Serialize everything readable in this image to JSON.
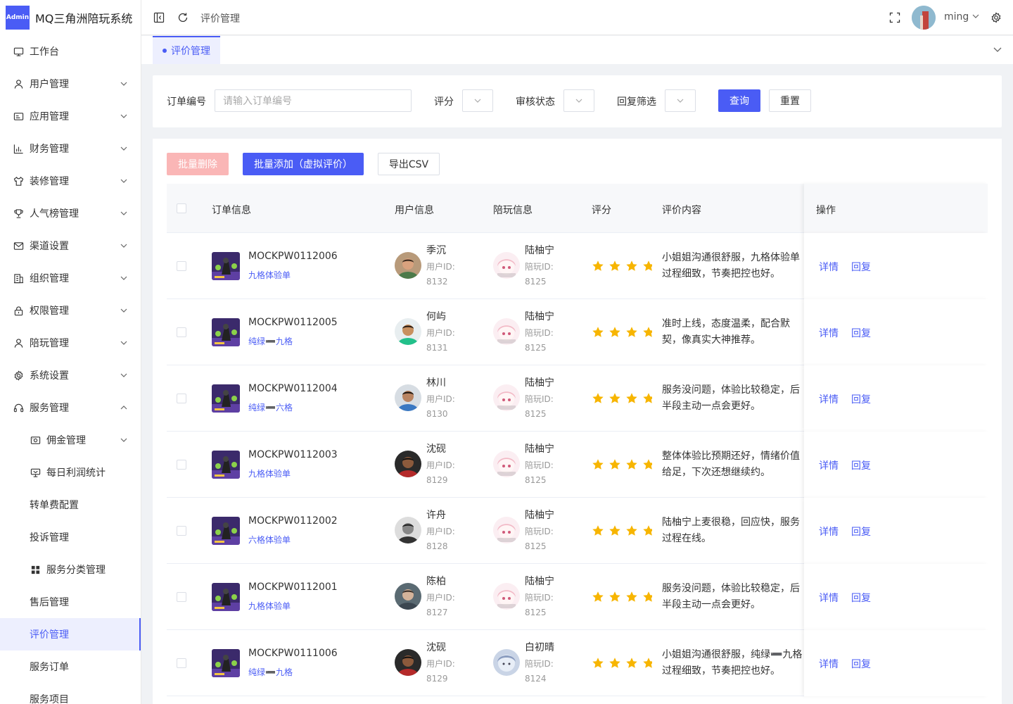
{
  "app": {
    "logo_badge": "Admin",
    "title": "MQ三角洲陪玩系统"
  },
  "sidebar": {
    "items": [
      {
        "label": "工作台",
        "icon": "monitor-icon",
        "expandable": false
      },
      {
        "label": "用户管理",
        "icon": "user-icon",
        "expandable": true
      },
      {
        "label": "应用管理",
        "icon": "app-icon",
        "expandable": true
      },
      {
        "label": "财务管理",
        "icon": "chart-icon",
        "expandable": true
      },
      {
        "label": "装修管理",
        "icon": "shirt-icon",
        "expandable": true
      },
      {
        "label": "人气榜管理",
        "icon": "trophy-icon",
        "expandable": true
      },
      {
        "label": "渠道设置",
        "icon": "mail-icon",
        "expandable": true
      },
      {
        "label": "组织管理",
        "icon": "building-icon",
        "expandable": true
      },
      {
        "label": "权限管理",
        "icon": "lock-icon",
        "expandable": true
      },
      {
        "label": "陪玩管理",
        "icon": "user-icon",
        "expandable": true
      },
      {
        "label": "系统设置",
        "icon": "gear-icon",
        "expandable": true
      },
      {
        "label": "服务管理",
        "icon": "headset-icon",
        "expandable": true,
        "expanded": true
      }
    ],
    "sub_items": [
      {
        "label": "佣金管理",
        "icon": "money-icon",
        "expandable": true
      },
      {
        "label": "每日利润统计",
        "icon": "cart-icon",
        "expandable": false
      },
      {
        "label": "转单费配置",
        "icon": "",
        "expandable": false
      },
      {
        "label": "投诉管理",
        "icon": "",
        "expandable": false
      },
      {
        "label": "服务分类管理",
        "icon": "grid-icon",
        "expandable": false
      },
      {
        "label": "售后管理",
        "icon": "",
        "expandable": false
      },
      {
        "label": "评价管理",
        "icon": "",
        "expandable": false,
        "active": true
      },
      {
        "label": "服务订单",
        "icon": "",
        "expandable": false
      },
      {
        "label": "服务项目",
        "icon": "",
        "expandable": false
      }
    ]
  },
  "header": {
    "breadcrumb": "评价管理",
    "username": "ming"
  },
  "tags": {
    "active": "评价管理"
  },
  "filter": {
    "order_no_label": "订单编号",
    "order_no_placeholder": "请输入订单编号",
    "rating_label": "评分",
    "audit_label": "审核状态",
    "reply_label": "回复筛选",
    "query_btn": "查询",
    "reset_btn": "重置"
  },
  "toolbar": {
    "batch_delete": "批量删除",
    "batch_add": "批量添加（虚拟评价）",
    "export_csv": "导出CSV"
  },
  "table": {
    "columns": [
      "订单信息",
      "用户信息",
      "陪玩信息",
      "评分",
      "评价内容",
      "操作"
    ],
    "user_id_label": "用户ID:",
    "companion_id_label": "陪玩ID:",
    "detail_label": "详情",
    "reply_label": "回复",
    "rows": [
      {
        "order_no": "MOCKPW0112006",
        "order_type": "九格体验单",
        "user_name": "季沉",
        "user_id": "8132",
        "companion_name": "陆柚宁",
        "companion_id": "8125",
        "rating": 5,
        "content": "小姐姐沟通很舒服，九格体验单过程细致，节奏把控也好。",
        "thumb": "purple",
        "user_avatar": "woman",
        "companion_avatar": "anime-pink"
      },
      {
        "order_no": "MOCKPW0112005",
        "order_type": "纯绿➖九格",
        "user_name": "何屿",
        "user_id": "8131",
        "companion_name": "陆柚宁",
        "companion_id": "8125",
        "rating": 5,
        "content": "准时上线，态度温柔，配合默契，像真实大神推荐。",
        "thumb": "purple",
        "user_avatar": "man-green",
        "companion_avatar": "anime-pink"
      },
      {
        "order_no": "MOCKPW0112004",
        "order_type": "纯绿➖六格",
        "user_name": "林川",
        "user_id": "8130",
        "companion_name": "陆柚宁",
        "companion_id": "8125",
        "rating": 5,
        "content": "服务没问题，体验比较稳定，后半段主动一点会更好。",
        "thumb": "purple",
        "user_avatar": "man-blue",
        "companion_avatar": "anime-pink"
      },
      {
        "order_no": "MOCKPW0112003",
        "order_type": "九格体验单",
        "user_name": "沈砚",
        "user_id": "8129",
        "companion_name": "陆柚宁",
        "companion_id": "8125",
        "rating": 5,
        "content": "整体体验比预期还好，情绪价值给足，下次还想继续约。",
        "thumb": "purple",
        "user_avatar": "man-red",
        "companion_avatar": "anime-pink"
      },
      {
        "order_no": "MOCKPW0112002",
        "order_type": "六格体验单",
        "user_name": "许舟",
        "user_id": "8128",
        "companion_name": "陆柚宁",
        "companion_id": "8125",
        "rating": 5,
        "content": "陆柚宁上麦很稳，回应快，服务过程在线。",
        "thumb": "purple",
        "user_avatar": "man-bw",
        "companion_avatar": "anime-pink"
      },
      {
        "order_no": "MOCKPW0112001",
        "order_type": "九格体验单",
        "user_name": "陈柏",
        "user_id": "8127",
        "companion_name": "陆柚宁",
        "companion_id": "8125",
        "rating": 5,
        "content": "服务没问题，体验比较稳定，后半段主动一点会更好。",
        "thumb": "purple",
        "user_avatar": "man-gray",
        "companion_avatar": "anime-pink"
      },
      {
        "order_no": "MOCKPW0111006",
        "order_type": "纯绿➖九格",
        "user_name": "沈砚",
        "user_id": "8129",
        "companion_name": "白初晴",
        "companion_id": "8124",
        "rating": 5,
        "content": "小姐姐沟通很舒服，纯绿➖九格过程细致，节奏把控也好。",
        "thumb": "purple",
        "user_avatar": "man-red",
        "companion_avatar": "anime-blue"
      }
    ]
  },
  "colors": {
    "primary": "#4a5cf5",
    "danger_disabled": "#fab6b6",
    "star": "#f7b500"
  }
}
